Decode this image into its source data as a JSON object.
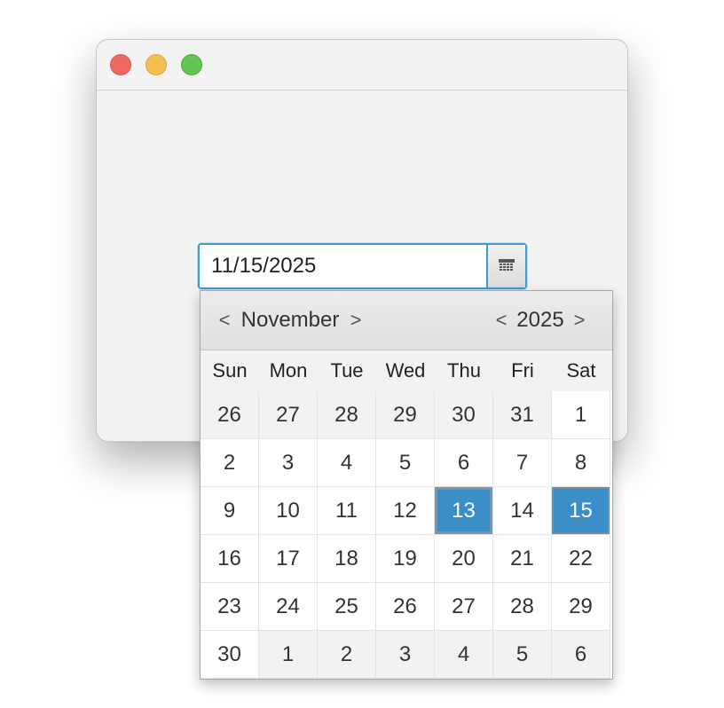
{
  "window": {
    "controls": {
      "close_color": "#ee6a5f",
      "minimize_color": "#f5bf4f",
      "zoom_color": "#61c554"
    }
  },
  "date_picker": {
    "value": "11/15/2025",
    "button_icon": "calendar-icon",
    "accent_color": "#3a8fc8"
  },
  "calendar": {
    "month": "November",
    "year": "2025",
    "prev_arrow": "<",
    "next_arrow": ">",
    "weekdays": [
      "Sun",
      "Mon",
      "Tue",
      "Wed",
      "Thu",
      "Fri",
      "Sat"
    ],
    "days": [
      [
        "26",
        "27",
        "28",
        "29",
        "30",
        "31",
        "1"
      ],
      [
        "2",
        "3",
        "4",
        "5",
        "6",
        "7",
        "8"
      ],
      [
        "9",
        "10",
        "11",
        "12",
        "13",
        "14",
        "15"
      ],
      [
        "16",
        "17",
        "18",
        "19",
        "20",
        "21",
        "22"
      ],
      [
        "23",
        "24",
        "25",
        "26",
        "27",
        "28",
        "29"
      ],
      [
        "30",
        "1",
        "2",
        "3",
        "4",
        "5",
        "6"
      ]
    ],
    "other_month_days": [
      [
        0,
        0
      ],
      [
        0,
        1
      ],
      [
        0,
        2
      ],
      [
        0,
        3
      ],
      [
        0,
        4
      ],
      [
        0,
        5
      ],
      [
        5,
        1
      ],
      [
        5,
        2
      ],
      [
        5,
        3
      ],
      [
        5,
        4
      ],
      [
        5,
        5
      ],
      [
        5,
        6
      ]
    ],
    "today": [
      2,
      4
    ],
    "selected": [
      2,
      6
    ]
  }
}
